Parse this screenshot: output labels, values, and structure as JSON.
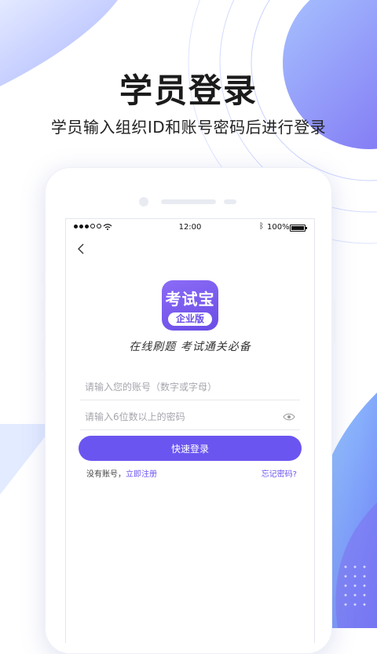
{
  "hero": {
    "title": "学员登录",
    "subtitle": "学员输入组织ID和账号密码后进行登录"
  },
  "status_bar": {
    "time": "12:00",
    "battery": "100%"
  },
  "app": {
    "logo_text": "考试宝",
    "logo_badge": "企业版",
    "slogan": "在线刷题  考试通关必备"
  },
  "form": {
    "account_placeholder": "请输入您的账号（数字或字母）",
    "password_placeholder": "请输入6位数以上的密码",
    "login_label": "快速登录",
    "no_account_label": "没有账号，",
    "register_label": "立即注册",
    "forgot_label": "忘记密码?"
  },
  "colors": {
    "accent": "#6b55f0",
    "background_blob": "#7c8cf8"
  },
  "icons": [
    "back-arrow-icon",
    "wifi-icon",
    "bluetooth-icon",
    "battery-icon",
    "eye-icon"
  ]
}
